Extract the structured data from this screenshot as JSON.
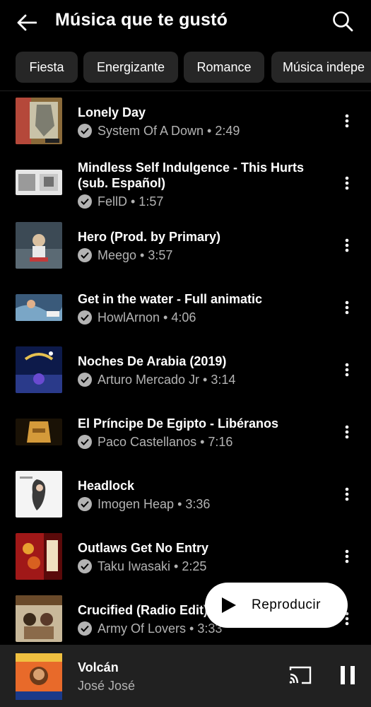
{
  "header": {
    "title": "Música que te gustó",
    "back_icon": "arrow-back-icon",
    "search_icon": "search-icon"
  },
  "chips": [
    "Fiesta",
    "Energizante",
    "Romance",
    "Música indepe"
  ],
  "tracks": [
    {
      "title": "Lonely Day",
      "subtitle": "System Of A Down • 2:49"
    },
    {
      "title": "Mindless Self Indulgence - This Hurts (sub. Español)",
      "subtitle": "FellD • 1:57"
    },
    {
      "title": "Hero (Prod. by Primary)",
      "subtitle": "Meego • 3:57"
    },
    {
      "title": "Get in the water - Full animatic",
      "subtitle": "HowlArnon • 4:06"
    },
    {
      "title": "Noches De Arabia (2019)",
      "subtitle": "Arturo Mercado Jr • 3:14"
    },
    {
      "title": "El Príncipe De Egipto - Libéranos",
      "subtitle": "Paco Castellanos • 7:16"
    },
    {
      "title": "Headlock",
      "subtitle": "Imogen Heap • 3:36"
    },
    {
      "title": "Outlaws Get No Entry",
      "subtitle": "Taku Iwasaki • 2:25"
    },
    {
      "title": "Crucified (Radio Edit)",
      "subtitle": "Army Of Lovers • 3:33"
    }
  ],
  "play_button": {
    "label": "Reproducir"
  },
  "now_playing": {
    "title": "Volcán",
    "artist": "José José"
  },
  "colors": {
    "background": "#000000",
    "chip": "#262626",
    "mini_player": "#212121",
    "secondary_text": "#b3b3b3"
  }
}
